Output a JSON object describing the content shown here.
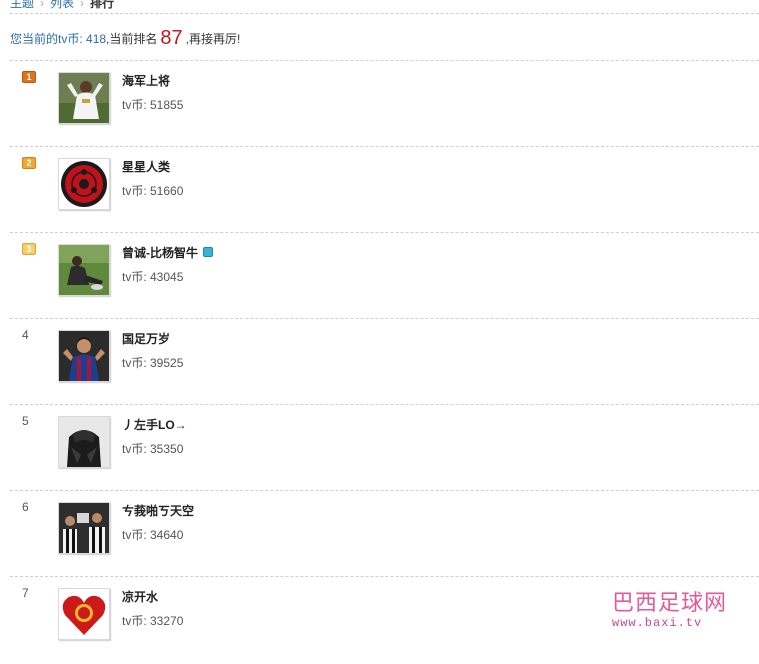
{
  "breadcrumb": {
    "items": [
      "主题",
      "列表"
    ],
    "current": "排行"
  },
  "summary": {
    "prefix": "您当前的tv币:",
    "coins": "418",
    "mid": ",当前排名",
    "rank": "87",
    "suffix": ",再接再厉!"
  },
  "ranking": [
    {
      "rank": "1",
      "name": "海军上将",
      "coin_label": "tv币: 51855",
      "badge": true,
      "vip": false,
      "avatar": "soccer-player-avatar"
    },
    {
      "rank": "2",
      "name": "星星人类",
      "coin_label": "tv币: 51660",
      "badge": true,
      "vip": false,
      "avatar": "sharingan-eye-avatar"
    },
    {
      "rank": "3",
      "name": "曾诚-比杨智牛",
      "coin_label": "tv币: 43045",
      "badge": true,
      "vip": true,
      "avatar": "goalkeeper-avatar"
    },
    {
      "rank": "4",
      "name": "国足万岁",
      "coin_label": "tv币: 39525",
      "badge": false,
      "vip": false,
      "avatar": "barcelona-player-avatar"
    },
    {
      "rank": "5",
      "name": "丿左手LO→",
      "coin_label": "tv币: 35350",
      "badge": false,
      "vip": false,
      "avatar": "dark-portrait-avatar"
    },
    {
      "rank": "6",
      "name": "ㄘ莪啪ㄎ天空",
      "coin_label": "tv币: 34640",
      "badge": false,
      "vip": false,
      "avatar": "juventus-team-avatar"
    },
    {
      "rank": "7",
      "name": "凉开水",
      "coin_label": "tv币: 33270",
      "badge": false,
      "vip": false,
      "avatar": "manutd-heart-avatar"
    }
  ],
  "watermark": {
    "title": "巴西足球网",
    "url": "www.baxi.tv"
  },
  "colors": {
    "link": "#2a6da8",
    "rank_highlight": "#c0191e",
    "badge_1": "#e2731d",
    "badge_2": "#f0a92d",
    "badge_3": "#f6cd68",
    "watermark": "#e35a9a"
  }
}
